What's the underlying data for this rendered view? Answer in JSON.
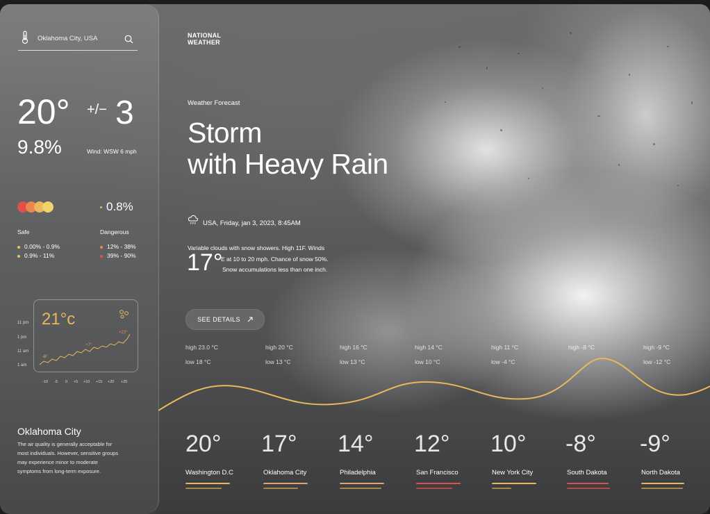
{
  "sidebar": {
    "search": {
      "value": "Oklahoma City, USA"
    },
    "temperature": "20°",
    "delta_sign": "+/−",
    "delta_value": "3",
    "humidity": "9.8%",
    "wind": "Wind: WSW 6 mph",
    "indicator_value": "0.8%",
    "safe": {
      "label": "Safe",
      "ranges": [
        "0.00% - 0.9%",
        "0.9% - 11%"
      ]
    },
    "dangerous": {
      "label": "Dangerous",
      "ranges": [
        "12% - 38%",
        "39% - 90%"
      ]
    },
    "mini_chart": {
      "temp": "21°c",
      "y_labels": [
        "11 pm",
        "1 pm",
        "11 am",
        "1 am"
      ],
      "x_labels": [
        "-10",
        "-5",
        "0",
        "+5",
        "+10",
        "+15",
        "+20",
        "+25"
      ],
      "annotations": [
        "-8°",
        "+7°",
        "+23°"
      ]
    },
    "city_title": "Oklahoma City",
    "city_desc_lines": [
      "The air quality is generally acceptable for",
      "most individuals. However, sensitive groups",
      "may experience minor to moderate",
      "symptoms from long-term exposure."
    ]
  },
  "brand": {
    "line1": "NATIONAL",
    "line2": "WEATHER"
  },
  "forecast": {
    "label": "Weather Forecast",
    "title_line1": "Storm",
    "title_line2": "with Heavy Rain",
    "datetime": "USA, Friday, jan 3, 2023, 8:45AM",
    "big_temp": "17°",
    "desc_line1": "Variable clouds with snow showers. High 11F. Winds",
    "desc_line2": "E at 10 to 20 mph. Chance of snow 50%.",
    "desc_line3": "Snow accumulations less than one inch.",
    "see_details": "SEE DETAILS"
  },
  "days": [
    {
      "high": "high 23.0 °C",
      "low": "low 18 °C"
    },
    {
      "high": "high 20 °C",
      "low": "low 13 °C"
    },
    {
      "high": "high 16 °C",
      "low": "low 13 °C"
    },
    {
      "high": "high 14 °C",
      "low": "low 10 °C"
    },
    {
      "high": "high 11 °C",
      "low": "low -4 °C"
    },
    {
      "high": "high -8 °C",
      "low": ""
    },
    {
      "high": "high -9 °C",
      "low": "low -12 °C"
    }
  ],
  "cities": [
    {
      "temp": "20°",
      "name": "Washington D.C"
    },
    {
      "temp": "17°",
      "name": "Oklahoma City"
    },
    {
      "temp": "14°",
      "name": "Philadelphia"
    },
    {
      "temp": "12°",
      "name": "San Francisco"
    },
    {
      "temp": "10°",
      "name": "New York City"
    },
    {
      "temp": "-8°",
      "name": "South Dakota"
    },
    {
      "temp": "-9°",
      "name": "North Dakota"
    }
  ],
  "colors": {
    "accent_gold": "#e8b85a",
    "indicator_circles": [
      "#e2504a",
      "#e8874f",
      "#e8b85a",
      "#f2d36b"
    ],
    "safe_dot": "#e8c45a",
    "danger_dot": "#e2504a"
  }
}
